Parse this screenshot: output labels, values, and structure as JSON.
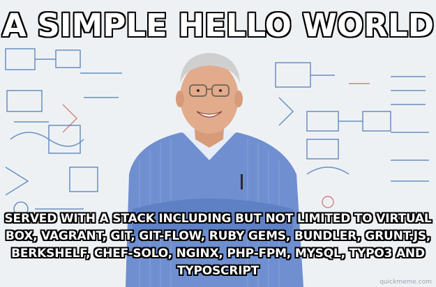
{
  "meme": {
    "top_text": "A SIMPLE HELLO WORLD",
    "bottom_text": "SERVED WITH A STACK INCLUDING BUT NOT LIMITED TO VIRTUAL BOX, VAGRANT, GIT, GIT-FLOW, RUBY GEMS, BUNDLER, GRUNT.JS, BERKSHELF, CHEF-SOLO, NGINX, PHP-FPM, MYSQL, TYPO3 AND TYPOSCRIPT",
    "watermark": "quickmeme.com"
  },
  "colors": {
    "shirt": "#6f8fd0",
    "skin": "#e2ab8c",
    "hair": "#cfcfcf",
    "whiteboard": "#eef1f4",
    "text": "#ffffff"
  }
}
